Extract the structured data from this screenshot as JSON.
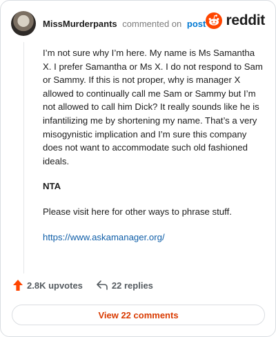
{
  "header": {
    "username": "MissMurderpants",
    "action": "commented on",
    "post_link": "post",
    "brand": "reddit"
  },
  "comment": {
    "paragraph_1": "I’m not sure why I’m here. My name is Ms Samantha X. I prefer Samantha or Ms X. I do not respond to Sam or Sammy. If this is not proper, why is manager X allowed to continually call me Sam or Sammy but I’m not allowed to call him Dick? It really sounds like he is infantilizing me by shortening my name. That’s a very misogynistic implication and I’m sure this company does not want to accommodate such old fashioned ideals.",
    "paragraph_2": "NTA",
    "paragraph_3": "Please visit here for other ways to phrase stuff.",
    "link": "https://www.askamanager.org/"
  },
  "footer": {
    "upvotes": "2.8K upvotes",
    "replies": "22 replies",
    "view_button": "View 22 comments"
  },
  "colors": {
    "brand_orange": "#ff4500",
    "link_blue": "#0079d3",
    "button_text": "#d93a00"
  },
  "icons": [
    "avatar-image",
    "reddit-logo-icon",
    "upvote-arrow-icon",
    "reply-arrow-icon"
  ]
}
